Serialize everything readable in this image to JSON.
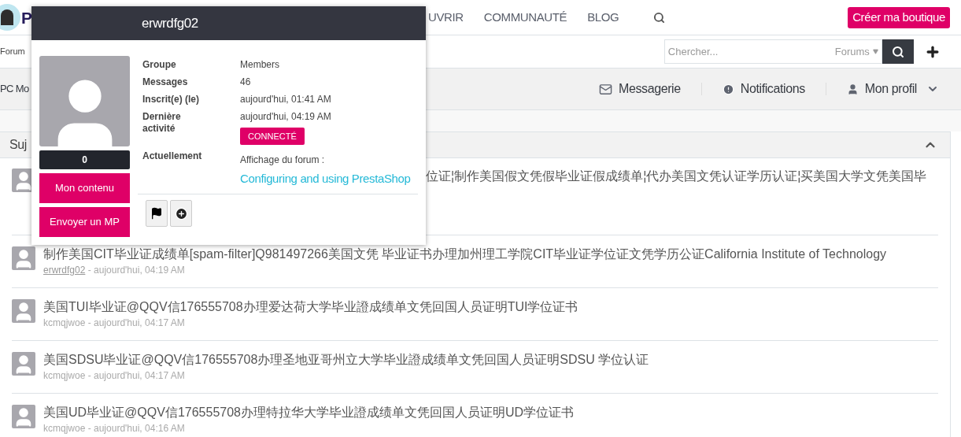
{
  "header": {
    "logo_letter": "P",
    "nav": [
      "UVRIR",
      "COMMUNAUTÉ",
      "BLOG"
    ],
    "cta": "Créer ma boutique"
  },
  "subbar": {
    "breadcrumb": "Forum",
    "search": {
      "placeholder": "Chercher...",
      "scope": "Forums"
    }
  },
  "userbar": {
    "title": "PC Mo",
    "links": [
      {
        "kind": "mail",
        "label": "Messagerie"
      },
      {
        "kind": "alert",
        "label": "Notifications"
      },
      {
        "kind": "user",
        "label": "Mon profil"
      }
    ]
  },
  "section": {
    "title": "Suj",
    "expanded": true
  },
  "topics": [
    {
      "title": "位证¦制作美国假文凭假毕业证假成绩单¦代办美国文凭认证学历认证¦买美国大学文凭美国毕",
      "covered": true
    },
    {
      "title": "制作美国CIT毕业证成绩单[spam-filter]Q981497266美国文凭 毕业证书办理加州理工学院CIT毕业证学位证文凭学历公证California Institute of Technology",
      "author": "erwrdfg02",
      "hovered": true,
      "time": " - aujourd'hui, 04:19 AM",
      "covered": false
    },
    {
      "title": "美国TUI毕业证@QQV信176555708办理爱达荷大学毕业證成绩单文凭回国人员证明TUI学位证书",
      "author": "kcmqjwoe",
      "hovered": false,
      "time": " - aujourd'hui, 04:17 AM",
      "covered": false
    },
    {
      "title": "美国SDSU毕业证@QQV信176555708办理圣地亚哥州立大学毕业證成绩单文凭回国人员证明SDSU 学位认证",
      "author": "kcmqjwoe",
      "hovered": false,
      "time": " - aujourd'hui, 04:17 AM",
      "covered": false
    },
    {
      "title": "美国UD毕业证@QQV信176555708办理特拉华大学毕业證成绩单文凭回国人员证明UD学位证书",
      "author": "kcmqjwoe",
      "hovered": false,
      "time": " - aujourd'hui, 04:16 AM",
      "covered": false
    }
  ],
  "popup": {
    "username": "erwrdfg02",
    "reputation": "0",
    "buttons": [
      "Mon contenu",
      "Envoyer un MP"
    ],
    "fields": [
      {
        "label": "Groupe",
        "value": "Members"
      },
      {
        "label": "Messages",
        "value": "46"
      },
      {
        "label": "Inscrit(e) (le)",
        "value": "aujourd'hui, 01:41 AM"
      },
      {
        "label": "Dernière activité",
        "value": "aujourd'hui, 04:19 AM",
        "online": true
      }
    ],
    "status_badge": "CONNECTÉ",
    "activity": {
      "label": "Actuellement",
      "prefix": "Affichage du forum :",
      "link": "Configuring and using PrestaShop"
    },
    "actions": [
      {
        "kind": "flag"
      },
      {
        "kind": "add"
      }
    ]
  }
}
